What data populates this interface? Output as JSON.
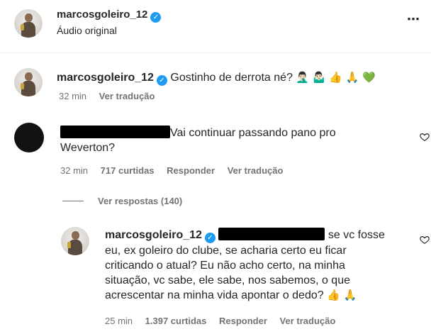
{
  "post_header": {
    "username": "marcosgoleiro_12",
    "subtitle": "Áudio original",
    "more_glyph": "⋯"
  },
  "caption": {
    "username": "marcosgoleiro_12",
    "text": "Gostinho de derrota né?",
    "emojis": "🤦🏻‍♂️ 🤷🏻‍♂️ 👍 🙏 💚",
    "time": "32 min",
    "translate": "Ver tradução"
  },
  "comment": {
    "text_line1": "Vai continuar passando pano pro",
    "text_line2": "Weverton?",
    "time": "32 min",
    "likes": "717 curtidas",
    "reply": "Responder",
    "translate": "Ver tradução",
    "view_replies": "Ver respostas (140)"
  },
  "reply": {
    "username": "marcosgoleiro_12",
    "text_line1_suffix": "se vc fosse",
    "text_line2": "eu, ex goleiro do clube, se acharia certo eu ficar",
    "text_line3": "criticando o atual? Eu não acho certo, na minha",
    "text_line4": "situação, vc sabe, ele sabe, nos sabemos, o que",
    "text_line5": "acrescentar na minha vida apontar o dedo?",
    "emojis": "👍 🙏",
    "time": "25 min",
    "likes": "1.397 curtidas",
    "reply": "Responder",
    "translate": "Ver tradução"
  },
  "colors": {
    "verified": "#1d9bf0",
    "secondary_text": "#737373",
    "primary_text": "#262626"
  }
}
